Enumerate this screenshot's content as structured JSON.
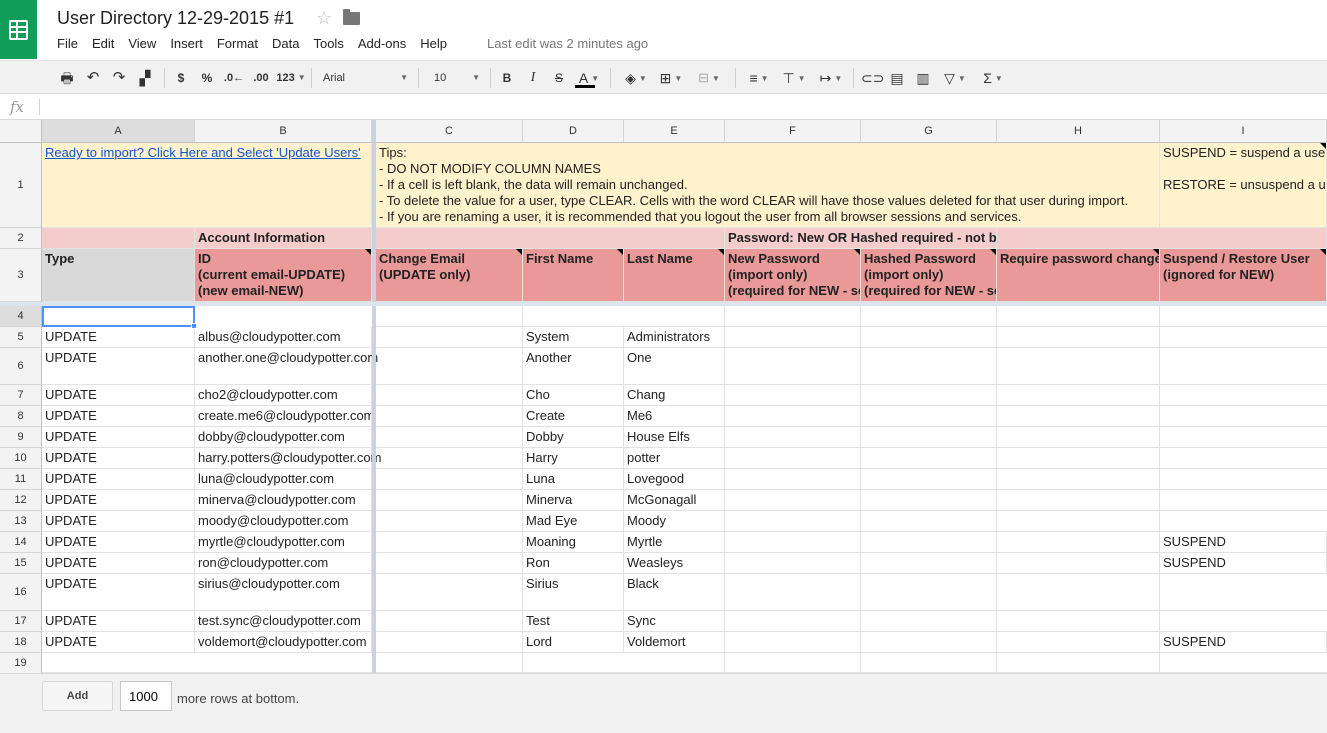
{
  "app": {
    "title": "User Directory 12-29-2015 #1",
    "last_edit": "Last edit was 2 minutes ago",
    "icons": [
      "sheets-logo-icon",
      "star-icon",
      "folder-icon"
    ]
  },
  "menu": [
    "File",
    "Edit",
    "View",
    "Insert",
    "Format",
    "Data",
    "Tools",
    "Add-ons",
    "Help"
  ],
  "toolbar": {
    "currency": "$",
    "percent": "%",
    "decrease_decimals": ".0←",
    "increase_decimals": ".00",
    "more_formats": "123",
    "font": "Arial",
    "font_size": "10",
    "bold": "B",
    "italic": "I",
    "strike": "S",
    "text_color": "A",
    "function": "Σ"
  },
  "formula_bar": {
    "label": "fx",
    "value": ""
  },
  "columns": [
    "A",
    "B",
    "C",
    "D",
    "E",
    "F",
    "G",
    "H",
    "I"
  ],
  "rows": [
    "1",
    "2",
    "3",
    "4",
    "5",
    "6",
    "7",
    "8",
    "9",
    "10",
    "11",
    "12",
    "13",
    "14",
    "15",
    "16",
    "17",
    "18",
    "19"
  ],
  "sheet": {
    "r1": {
      "a": "Ready to import? Click Here and Select 'Update Users'",
      "tips": [
        "Tips:",
        "- DO NOT MODIFY COLUMN NAMES",
        "- If a cell is left blank, the data will remain unchanged.",
        "- To delete the value for a user, type CLEAR. Cells with the word CLEAR will have those values deleted for that user during import.",
        "- If you are renaming a user, it is recommended that you logout the user from all browser sessions and services."
      ],
      "i": [
        "SUSPEND = suspend a user",
        "RESTORE = unsuspend a user"
      ]
    },
    "r2": {
      "b": "Account Information",
      "f": "Password: New OR Hashed required - not both"
    },
    "r3": {
      "a": "Type",
      "b": [
        "ID",
        "(current email-UPDATE)",
        "(new email-NEW)"
      ],
      "c": [
        "Change Email",
        "(UPDATE only)"
      ],
      "d": "First Name",
      "e": "Last Name",
      "f": [
        "New Password",
        "(import only)",
        "(required for NEW - see note)"
      ],
      "g": [
        "Hashed Password",
        "(import only)",
        "(required for NEW - see note)"
      ],
      "h": "Require password change",
      "i": [
        "Suspend / Restore User",
        "(ignored for NEW)"
      ]
    },
    "users": [
      {
        "type": "UPDATE",
        "id": "albus@cloudypotter.com",
        "first": "System",
        "last": "Administrators",
        "suspend": ""
      },
      {
        "type": "UPDATE",
        "id": "another.one@cloudypotter.com",
        "first": "Another",
        "last": "One",
        "suspend": ""
      },
      {
        "type": "UPDATE",
        "id": "cho2@cloudypotter.com",
        "first": "Cho",
        "last": "Chang",
        "suspend": ""
      },
      {
        "type": "UPDATE",
        "id": "create.me6@cloudypotter.com",
        "first": "Create",
        "last": "Me6",
        "suspend": ""
      },
      {
        "type": "UPDATE",
        "id": "dobby@cloudypotter.com",
        "first": "Dobby",
        "last": "House Elfs",
        "suspend": ""
      },
      {
        "type": "UPDATE",
        "id": "harry.potters@cloudypotter.com",
        "first": "Harry",
        "last": "potter",
        "suspend": ""
      },
      {
        "type": "UPDATE",
        "id": "luna@cloudypotter.com",
        "first": "Luna",
        "last": "Lovegood",
        "suspend": ""
      },
      {
        "type": "UPDATE",
        "id": "minerva@cloudypotter.com",
        "first": "Minerva",
        "last": "McGonagall",
        "suspend": ""
      },
      {
        "type": "UPDATE",
        "id": "moody@cloudypotter.com",
        "first": "Mad Eye",
        "last": "Moody",
        "suspend": ""
      },
      {
        "type": "UPDATE",
        "id": "myrtle@cloudypotter.com",
        "first": "Moaning",
        "last": "Myrtle",
        "suspend": "SUSPEND"
      },
      {
        "type": "UPDATE",
        "id": "ron@cloudypotter.com",
        "first": "Ron",
        "last": "Weasleys",
        "suspend": "SUSPEND"
      },
      {
        "type": "UPDATE",
        "id": "sirius@cloudypotter.com",
        "first": "Sirius",
        "last": "Black",
        "suspend": ""
      },
      {
        "type": "UPDATE",
        "id": "test.sync@cloudypotter.com",
        "first": "Test",
        "last": "Sync",
        "suspend": ""
      },
      {
        "type": "UPDATE",
        "id": "voldemort@cloudypotter.com",
        "first": "Lord",
        "last": "Voldemort",
        "suspend": "SUSPEND"
      }
    ]
  },
  "footer": {
    "add_label": "Add",
    "rows_value": "1000",
    "rows_label": "more rows at bottom."
  },
  "colors": {
    "header_red": "#ea9999",
    "header_pink": "#f4cccc",
    "tips_yellow": "#fff2cc",
    "brand_green": "#0f9d58",
    "selection_blue": "#4d90fe"
  }
}
